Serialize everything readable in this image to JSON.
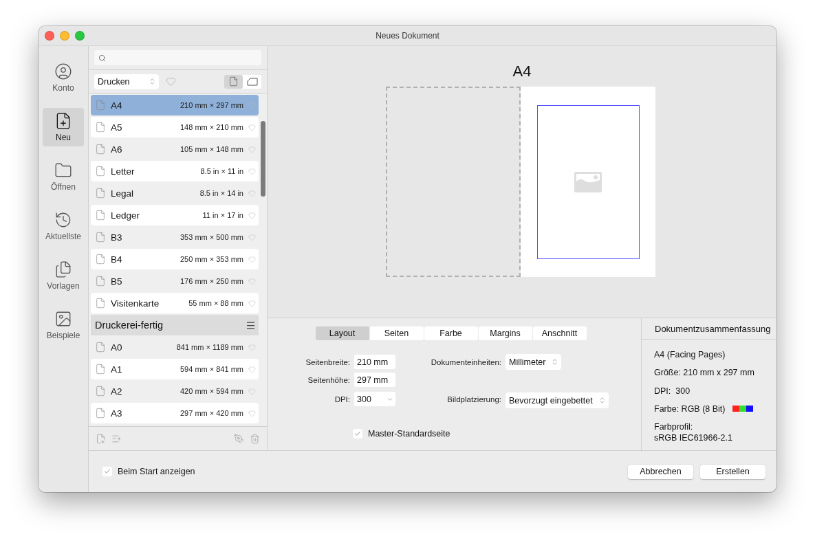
{
  "window": {
    "title": "Neues Dokument"
  },
  "sidebar": {
    "items": [
      {
        "label": "Konto",
        "kind": "account",
        "selected": false
      },
      {
        "label": "Neu",
        "kind": "new",
        "selected": true
      },
      {
        "label": "Öffnen",
        "kind": "open",
        "selected": false
      },
      {
        "label": "Aktuellste",
        "kind": "recent",
        "selected": false
      },
      {
        "label": "Vorlagen",
        "kind": "templates",
        "selected": false
      },
      {
        "label": "Beispiele",
        "kind": "samples",
        "selected": false
      }
    ]
  },
  "presets": {
    "category": "Drucken",
    "orientations": [
      {
        "kind": "portrait",
        "selected": true
      },
      {
        "kind": "landscape",
        "selected": false
      }
    ],
    "groups": [
      {
        "items": [
          {
            "name": "A4",
            "size": "210 mm × 297 mm",
            "selected": true
          },
          {
            "name": "A5",
            "size": "148 mm × 210 mm",
            "selected": false
          },
          {
            "name": "A6",
            "size": "105 mm × 148 mm",
            "selected": false
          },
          {
            "name": "Letter",
            "size": "8.5 in × 11 in",
            "selected": false
          },
          {
            "name": "Legal",
            "size": "8.5 in × 14 in",
            "selected": false
          },
          {
            "name": "Ledger",
            "size": "11 in × 17 in",
            "selected": false
          },
          {
            "name": "B3",
            "size": "353 mm × 500 mm",
            "selected": false
          },
          {
            "name": "B4",
            "size": "250 mm × 353 mm",
            "selected": false
          },
          {
            "name": "B5",
            "size": "176 mm × 250 mm",
            "selected": false
          },
          {
            "name": "Visitenkarte",
            "size": "55 mm × 88 mm",
            "selected": false
          }
        ]
      },
      {
        "title": "Druckerei-fertig",
        "items": [
          {
            "name": "A0",
            "size": "841 mm × 1189 mm",
            "selected": false
          },
          {
            "name": "A1",
            "size": "594 mm × 841 mm",
            "selected": false
          },
          {
            "name": "A2",
            "size": "420 mm × 594 mm",
            "selected": false
          },
          {
            "name": "A3",
            "size": "297 mm × 420 mm",
            "selected": false
          }
        ]
      }
    ]
  },
  "preview": {
    "title": "A4"
  },
  "tabs": [
    {
      "label": "Layout",
      "selected": true
    },
    {
      "label": "Seiten",
      "selected": false
    },
    {
      "label": "Farbe",
      "selected": false
    },
    {
      "label": "Margins",
      "selected": false
    },
    {
      "label": "Anschnitt",
      "selected": false
    }
  ],
  "layout": {
    "fields": [
      {
        "label": "Seitenbreite:",
        "value": "210 mm",
        "kind": "text"
      },
      {
        "label": "Seitenhöhe:",
        "value": "297 mm",
        "kind": "text"
      },
      {
        "label": "DPI:",
        "value": "300",
        "kind": "combo"
      }
    ],
    "selects": [
      {
        "label": "Dokumenteinheiten:",
        "value": "Millimeter"
      },
      {
        "label": "Bildplatzierung:",
        "value": "Bevorzugt eingebettet"
      }
    ],
    "master_page": {
      "label": "Master-Standardseite",
      "checked": true
    }
  },
  "summary": {
    "title": "Dokumentzusammenfassung",
    "lines": [
      {
        "text": "A4 (Facing Pages)",
        "kind": "plain"
      },
      {
        "text": "Größe: 210 mm x 297 mm",
        "kind": "plain"
      },
      {
        "text": "DPI:  300",
        "kind": "plain"
      },
      {
        "text": "Farbe: RGB (8 Bit)",
        "kind": "color"
      },
      {
        "text": "Farbprofil:\nsRGB IEC61966-2.1",
        "kind": "plain"
      }
    ]
  },
  "footer": {
    "show_on_start": {
      "label": "Beim Start anzeigen",
      "checked": true
    },
    "buttons": [
      "Abbrechen",
      "Erstellen"
    ]
  }
}
